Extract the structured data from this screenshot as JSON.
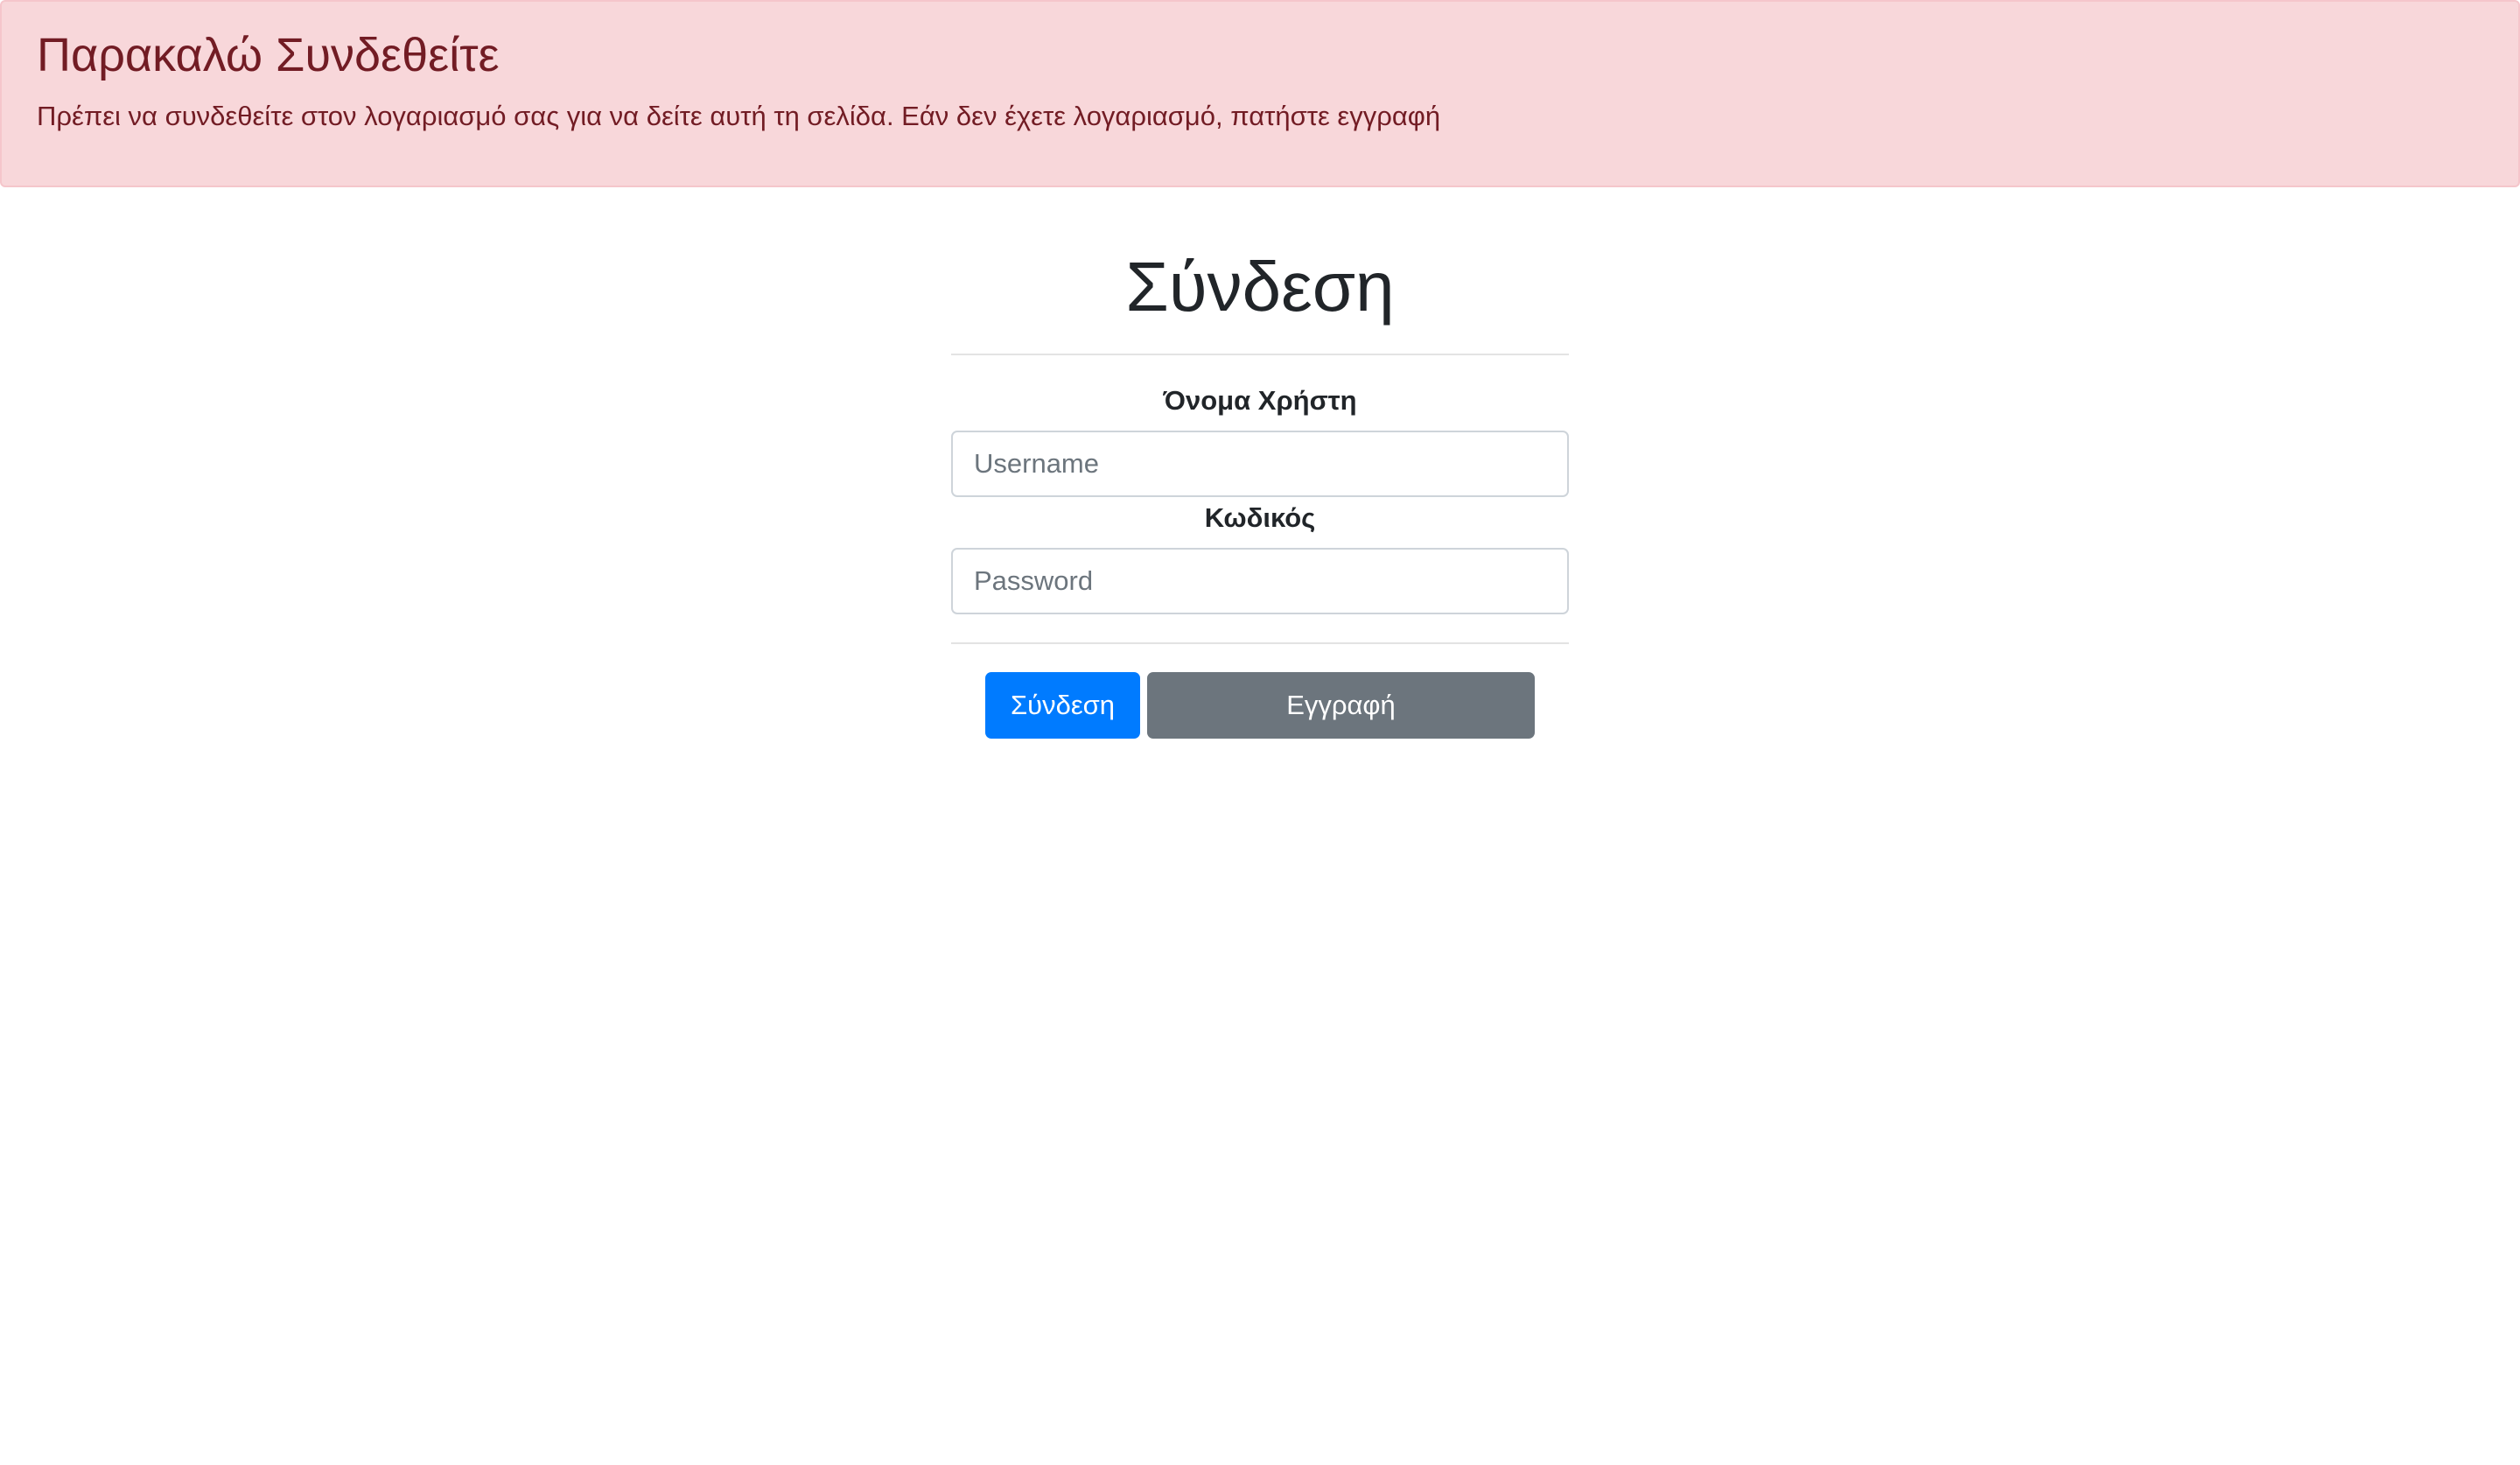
{
  "alert": {
    "heading": "Παρακαλώ Συνδεθείτε",
    "text": "Πρέπει να συνδεθείτε στον λογαριασμό σας για να δείτε αυτή τη σελίδα. Εάν δεν έχετε λογαριασμό, πατήστε εγγραφή"
  },
  "login": {
    "title": "Σύνδεση",
    "username_label": "Όνομα Χρήστη",
    "username_placeholder": "Username",
    "password_label": "Κωδικός",
    "password_placeholder": "Password",
    "login_button": "Σύνδεση",
    "register_button": "Εγγραφή"
  },
  "colors": {
    "alert_background": "#f8d7da",
    "alert_text": "#721c24",
    "primary": "#007bff",
    "secondary": "#6c757d"
  }
}
